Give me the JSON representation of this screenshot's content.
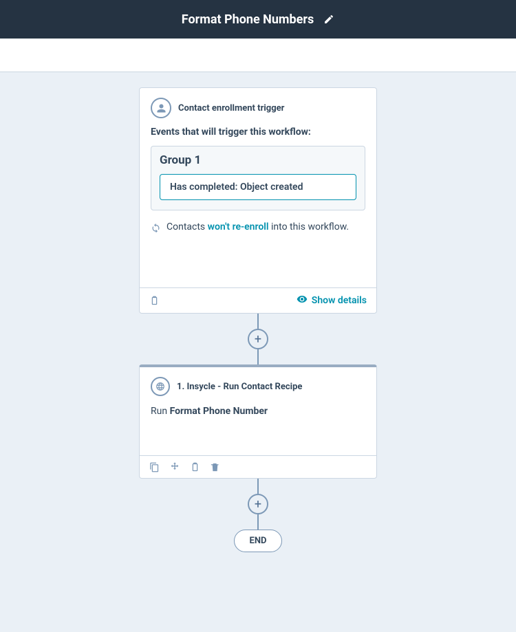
{
  "header": {
    "title": "Format Phone Numbers",
    "editIcon": "edit"
  },
  "trigger": {
    "label": "Contact enrollment trigger",
    "subheading": "Events that will trigger this workflow:",
    "group": {
      "title": "Group 1",
      "filter": "Has completed: Object created"
    },
    "reenroll": {
      "prefix": "Contacts ",
      "link": "won't re-enroll",
      "suffix": " into this workflow."
    },
    "showDetails": "Show details"
  },
  "step1": {
    "title": "1. Insycle - Run Contact Recipe",
    "descPrefix": "Run ",
    "descBold": "Format Phone Number"
  },
  "end": {
    "label": "END"
  },
  "icons": {
    "plus": "+"
  }
}
